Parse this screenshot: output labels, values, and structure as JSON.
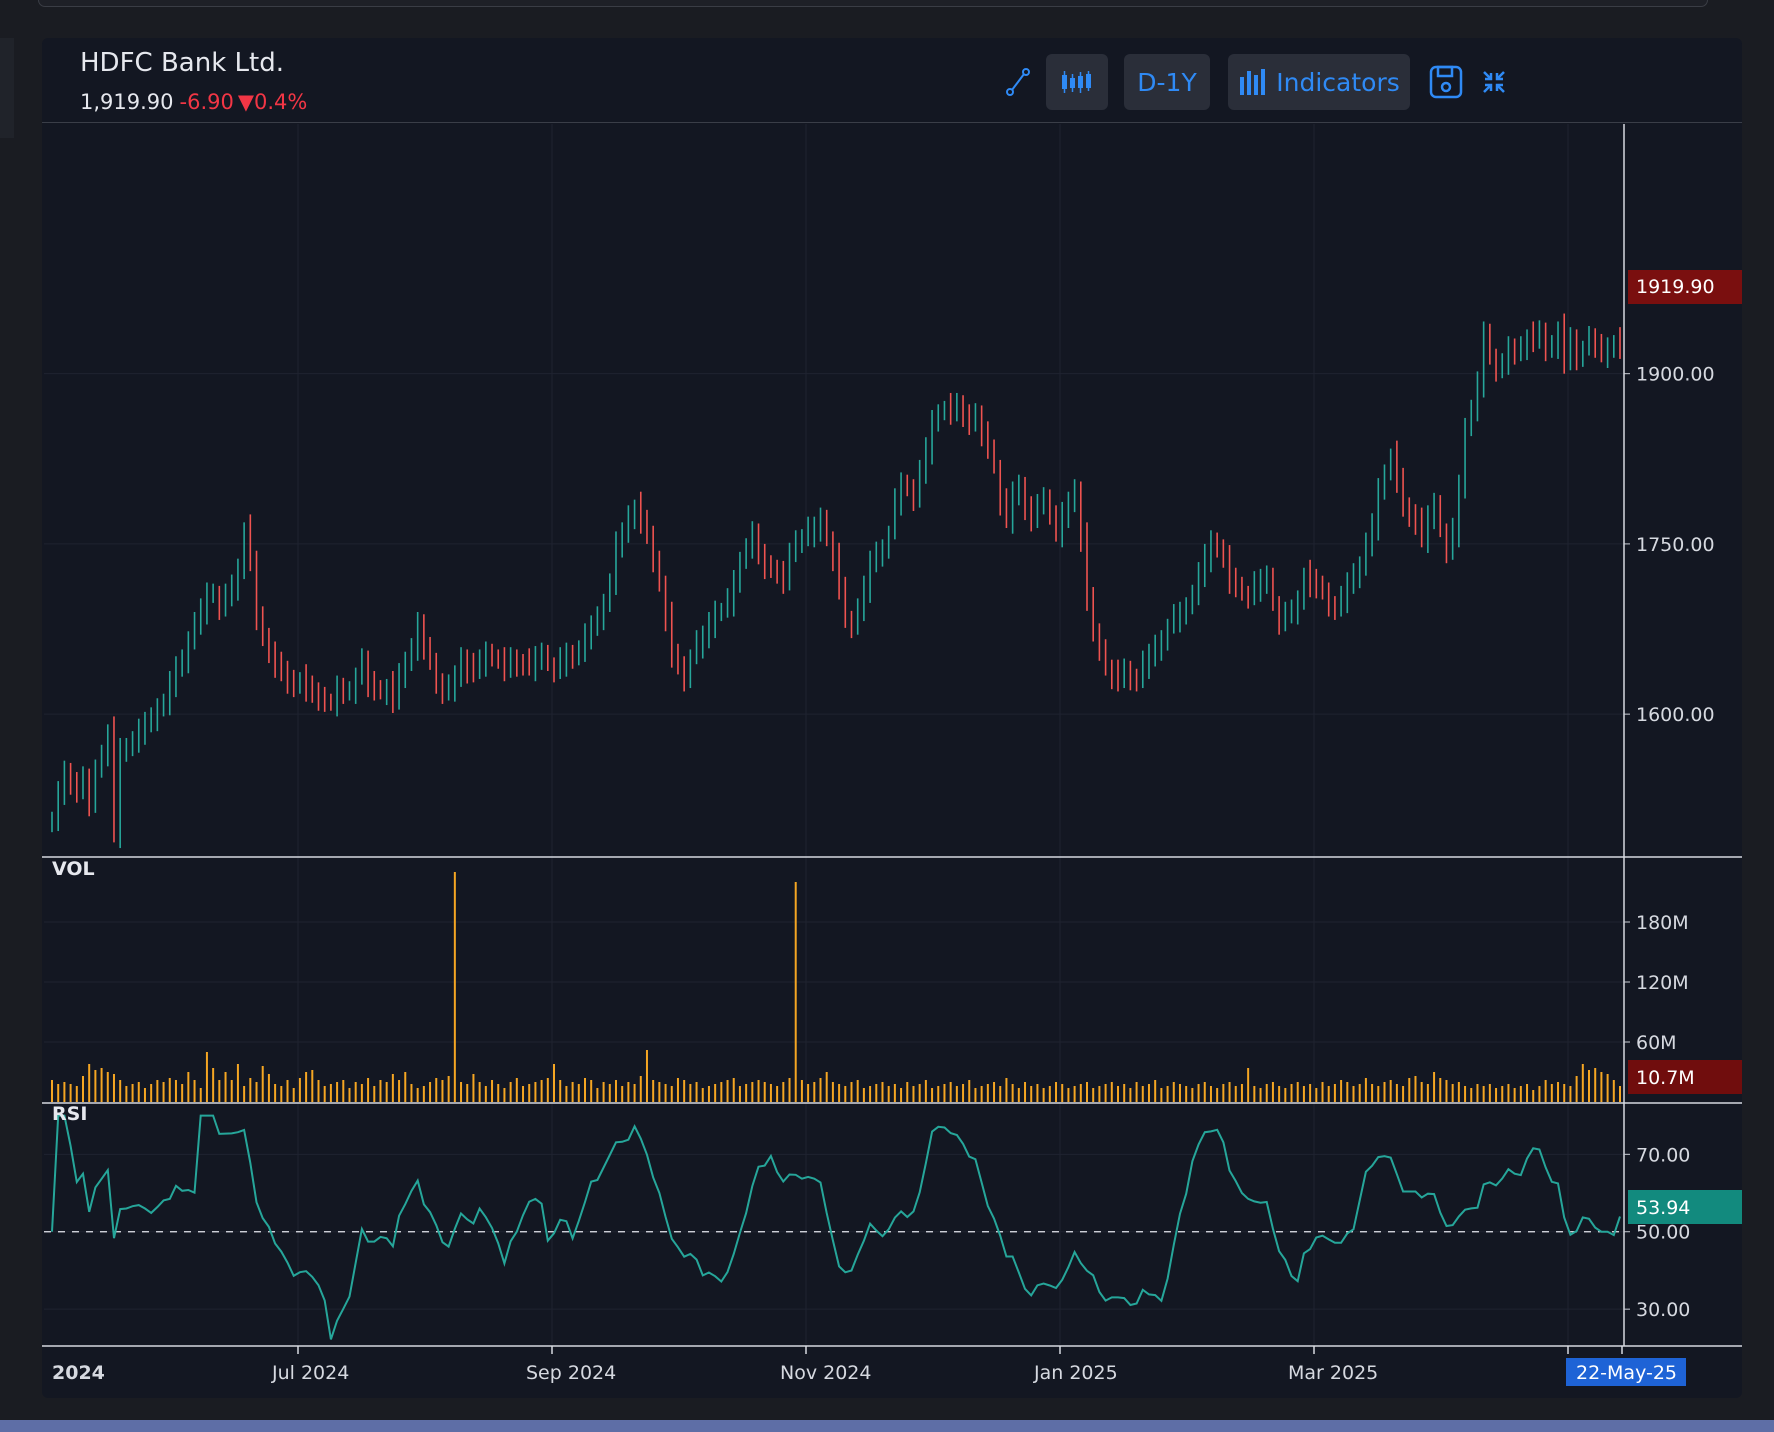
{
  "header": {
    "title": "HDFC Bank Ltd.",
    "last": "1,919.90",
    "change": "-6.90",
    "arrow": "▼",
    "change_pct": "0.4%"
  },
  "toolbar": {
    "draw_icon": "line-draw-icon",
    "chart_type_icon": "candlestick-icon",
    "period_label": "D-1Y",
    "indicators_label": "Indicators",
    "save_icon": "save-icon",
    "collapse_icon": "collapse-icon"
  },
  "colors": {
    "up": "#26a69a",
    "down": "#ef5350",
    "volume": "#f5a623",
    "rsi": "#26a69a",
    "last_price_tag": "#8b0000",
    "rsi_tag": "#128a7e",
    "date_tag": "#2962ff"
  },
  "chart_data": {
    "type": "candlestick",
    "x_ticks": [
      "2024",
      "Jul 2024",
      "Sep 2024",
      "Nov 2024",
      "Jan 2025",
      "Mar 2025"
    ],
    "cursor_date": "22-May-25",
    "price": {
      "y_ticks": [
        "1900.00",
        "1750.00",
        "1600.00"
      ],
      "y_tick_values": [
        1900,
        1750,
        1600
      ],
      "ylim": [
        1475,
        2120
      ],
      "last_label": "1919.90",
      "last_value": 1919.9,
      "closes": [
        1508,
        1528,
        1548,
        1542,
        1532,
        1540,
        1522,
        1550,
        1565,
        1585,
        1495,
        1568,
        1570,
        1578,
        1582,
        1590,
        1596,
        1606,
        1612,
        1625,
        1640,
        1648,
        1666,
        1676,
        1690,
        1706,
        1707,
        1696,
        1702,
        1712,
        1728,
        1762,
        1732,
        1685,
        1668,
        1658,
        1642,
        1636,
        1630,
        1624,
        1630,
        1622,
        1618,
        1616,
        1612,
        1610,
        1621,
        1618,
        1620,
        1634,
        1644,
        1628,
        1622,
        1620,
        1625,
        1610,
        1634,
        1646,
        1660,
        1676,
        1658,
        1646,
        1630,
        1618,
        1622,
        1632,
        1650,
        1640,
        1638,
        1645,
        1654,
        1651,
        1646,
        1640,
        1648,
        1646,
        1644,
        1641,
        1648,
        1653,
        1644,
        1639,
        1646,
        1652,
        1650,
        1658,
        1666,
        1675,
        1685,
        1698,
        1718,
        1748,
        1758,
        1775,
        1782,
        1768,
        1756,
        1736,
        1716,
        1686,
        1651,
        1642,
        1632,
        1650,
        1660,
        1666,
        1680,
        1692,
        1692,
        1698,
        1716,
        1734,
        1748,
        1756,
        1740,
        1732,
        1730,
        1722,
        1718,
        1740,
        1753,
        1756,
        1760,
        1762,
        1772,
        1755,
        1738,
        1710,
        1682,
        1678,
        1695,
        1708,
        1732,
        1742,
        1746,
        1760,
        1786,
        1802,
        1800,
        1792,
        1810,
        1832,
        1858,
        1865,
        1870,
        1866,
        1872,
        1866,
        1856,
        1860,
        1848,
        1834,
        1818,
        1786,
        1772,
        1794,
        1802,
        1778,
        1773,
        1782,
        1790,
        1778,
        1760,
        1774,
        1785,
        1798,
        1755,
        1700,
        1670,
        1658,
        1642,
        1635,
        1630,
        1638,
        1633,
        1629,
        1642,
        1650,
        1660,
        1666,
        1678,
        1684,
        1688,
        1694,
        1707,
        1720,
        1738,
        1752,
        1748,
        1736,
        1718,
        1712,
        1706,
        1704,
        1712,
        1716,
        1721,
        1698,
        1682,
        1686,
        1690,
        1700,
        1722,
        1716,
        1712,
        1708,
        1698,
        1692,
        1700,
        1714,
        1724,
        1732,
        1746,
        1765,
        1798,
        1812,
        1828,
        1806,
        1782,
        1778,
        1768,
        1754,
        1772,
        1785,
        1762,
        1744,
        1760,
        1800,
        1852,
        1870,
        1888,
        1934,
        1914,
        1904,
        1912,
        1920,
        1918,
        1924,
        1932,
        1928,
        1935,
        1922,
        1926,
        1940,
        1910,
        1930,
        1915,
        1922,
        1928,
        1925,
        1918,
        1924,
        1928,
        1920
      ],
      "count": 236
    },
    "volume": {
      "label": "VOL",
      "y_ticks": [
        "180M",
        "120M",
        "60M"
      ],
      "y_tick_values": [
        180,
        120,
        60
      ],
      "ylim": [
        0,
        230
      ],
      "unit": "M",
      "last_label": "10.7M",
      "spikes": [
        {
          "index": 65,
          "value": 230
        },
        {
          "index": 120,
          "value": 220
        }
      ],
      "base_values_m": [
        22,
        18,
        20,
        18,
        16,
        26,
        38,
        32,
        34,
        30,
        28,
        22,
        16,
        18,
        20,
        14,
        18,
        22,
        20,
        24,
        22,
        18,
        30,
        22,
        14,
        50,
        34,
        22,
        30,
        22,
        38,
        16,
        24,
        20,
        36,
        28,
        18,
        16,
        22,
        14,
        24,
        30,
        32,
        22,
        16,
        18,
        20,
        22,
        14,
        20,
        18,
        24,
        16,
        22,
        20,
        28,
        22,
        30,
        18,
        14,
        16,
        20,
        24,
        22,
        26,
        230,
        20,
        18,
        28,
        20,
        16,
        22,
        18,
        14,
        20,
        24,
        16,
        18,
        20,
        22,
        24,
        38,
        22,
        16,
        20,
        18,
        24,
        22,
        14,
        20,
        18,
        22,
        16,
        20,
        18,
        26,
        52,
        22,
        20,
        18,
        16,
        24,
        22,
        18,
        20,
        14,
        16,
        18,
        20,
        22,
        24,
        16,
        18,
        20,
        22,
        20,
        18,
        16,
        20,
        24,
        220,
        22,
        18,
        20,
        24,
        30,
        20,
        18,
        16,
        20,
        22,
        14,
        16,
        18,
        20,
        16,
        18,
        14,
        20,
        16,
        18,
        22,
        14,
        16,
        18,
        20,
        16,
        18,
        22,
        14,
        16,
        18,
        20,
        16,
        24,
        18,
        14,
        20,
        16,
        18,
        14,
        16,
        20,
        18,
        14,
        16,
        18,
        20,
        14,
        16,
        18,
        20,
        16,
        18,
        14,
        20,
        16,
        18,
        22,
        14,
        16,
        20,
        18,
        16,
        14,
        18,
        20,
        16,
        14,
        18,
        20,
        16,
        18,
        34,
        16,
        14,
        18,
        20,
        16,
        14,
        18,
        20,
        16,
        18,
        14,
        20,
        16,
        18,
        22,
        20,
        16,
        18,
        24,
        18,
        16,
        20,
        22,
        18,
        16,
        24,
        26,
        20,
        18,
        30,
        24,
        22,
        18,
        20,
        16,
        14,
        18,
        16,
        18,
        14,
        16,
        18,
        14,
        16,
        18,
        12,
        16
      ]
    },
    "rsi": {
      "label": "RSI",
      "y_ticks": [
        "70.00",
        "50.00",
        "30.00"
      ],
      "y_tick_values": [
        70,
        50,
        30
      ],
      "ylim": [
        21,
        83
      ],
      "reference_level": 50,
      "last_label": "53.94",
      "last_value": 53.94
    }
  }
}
